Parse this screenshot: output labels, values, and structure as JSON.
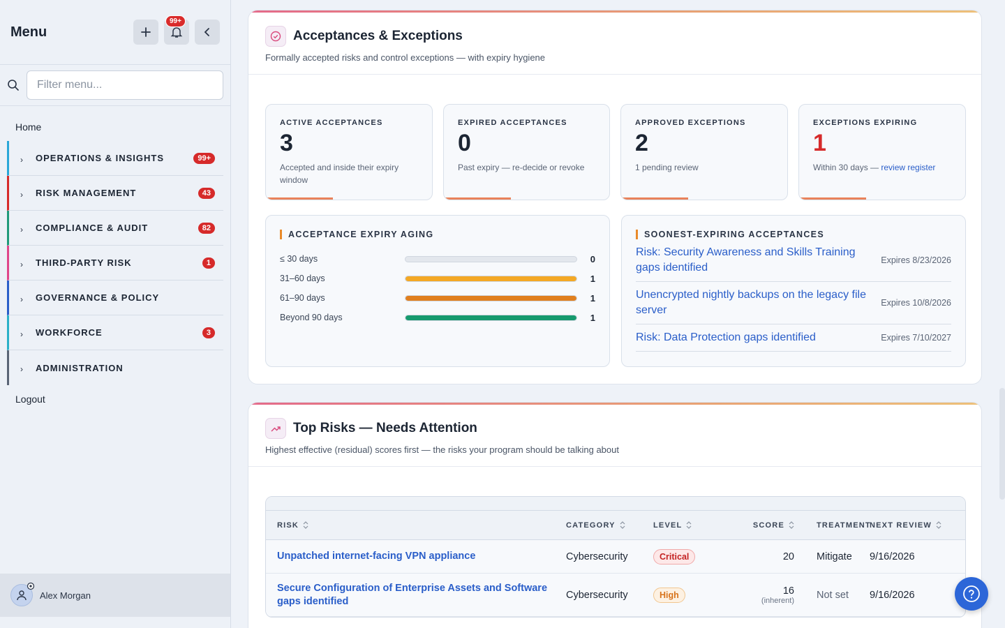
{
  "sidebar": {
    "title": "Menu",
    "notif_badge": "99+",
    "filter_placeholder": "Filter menu...",
    "home": "Home",
    "logout": "Logout",
    "items": [
      {
        "label": "OPERATIONS & INSIGHTS",
        "count": "99+",
        "color": "#2aa7d8"
      },
      {
        "label": "RISK MANAGEMENT",
        "count": "43",
        "color": "#d62a2a"
      },
      {
        "label": "COMPLIANCE & AUDIT",
        "count": "82",
        "color": "#1f9a7a"
      },
      {
        "label": "THIRD-PARTY RISK",
        "count": "1",
        "color": "#e0458a"
      },
      {
        "label": "GOVERNANCE & POLICY",
        "count": "",
        "color": "#2a5ec9"
      },
      {
        "label": "WORKFORCE",
        "count": "3",
        "color": "#2ab0c8"
      },
      {
        "label": "ADMINISTRATION",
        "count": "",
        "color": "#5a6475"
      }
    ],
    "user_name": "Alex Morgan"
  },
  "acceptances": {
    "title": "Acceptances & Exceptions",
    "subtitle": "Formally accepted risks and control exceptions — with expiry hygiene",
    "kpis": [
      {
        "label": "ACTIVE ACCEPTANCES",
        "value": "3",
        "desc": "Accepted and inside their expiry window"
      },
      {
        "label": "EXPIRED ACCEPTANCES",
        "value": "0",
        "desc": "Past expiry — re-decide or revoke"
      },
      {
        "label": "APPROVED EXCEPTIONS",
        "value": "2",
        "desc": "1 pending review"
      },
      {
        "label": "EXCEPTIONS EXPIRING",
        "value": "1",
        "desc": "Within 30 days — ",
        "link": "review register"
      }
    ],
    "aging": {
      "title": "ACCEPTANCE EXPIRY AGING",
      "rows": [
        {
          "label": "≤ 30 days",
          "value": 0,
          "display": "0",
          "color": "#e3e7ed"
        },
        {
          "label": "31–60 days",
          "value": 1,
          "display": "1",
          "color": "#f4a825"
        },
        {
          "label": "61–90 days",
          "value": 1,
          "display": "1",
          "color": "#e07f1e"
        },
        {
          "label": "Beyond 90 days",
          "value": 1,
          "display": "1",
          "color": "#169a6e"
        }
      ]
    },
    "soonest": {
      "title": "SOONEST-EXPIRING ACCEPTANCES",
      "rows": [
        {
          "title": "Risk: Security Awareness and Skills Training gaps identified",
          "expires": "Expires 8/23/2026"
        },
        {
          "title": "Unencrypted nightly backups on the legacy file server",
          "expires": "Expires 10/8/2026"
        },
        {
          "title": "Risk: Data Protection gaps identified",
          "expires": "Expires 7/10/2027"
        }
      ]
    }
  },
  "top_risks": {
    "title": "Top Risks — Needs Attention",
    "subtitle": "Highest effective (residual) scores first — the risks your program should be talking about",
    "columns": {
      "risk": "RISK",
      "category": "CATEGORY",
      "level": "LEVEL",
      "score": "SCORE",
      "treatment": "TREATMENT",
      "next_review": "NEXT REVIEW"
    },
    "rows": [
      {
        "risk": "Unpatched internet-facing VPN appliance",
        "category": "Cybersecurity",
        "level": "Critical",
        "score": "20",
        "score_note": "",
        "treatment": "Mitigate",
        "next_review": "9/16/2026"
      },
      {
        "risk": "Secure Configuration of Enterprise Assets and Software gaps identified",
        "category": "Cybersecurity",
        "level": "High",
        "score": "16",
        "score_note": "(inherent)",
        "treatment": "Not set",
        "next_review": "9/16/2026"
      }
    ]
  }
}
